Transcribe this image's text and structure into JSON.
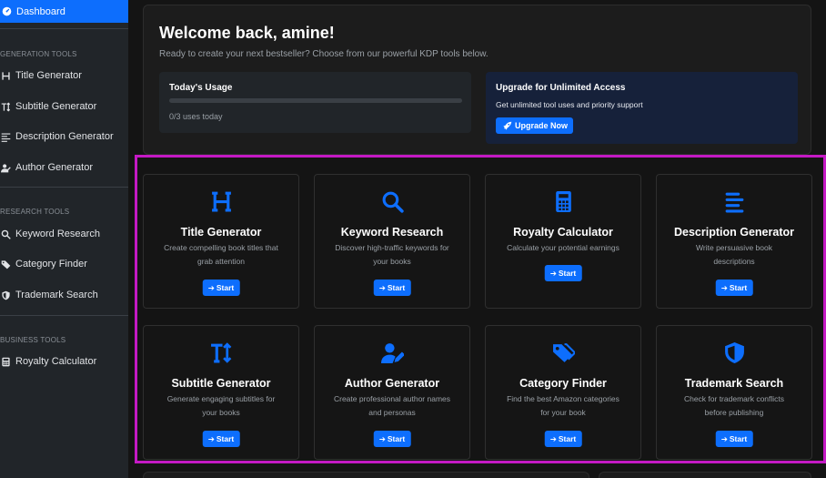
{
  "sidebar": {
    "dashboard": {
      "label": "Dashboard",
      "icon": "dashboard-icon"
    },
    "sections": [
      {
        "heading": "GENERATION TOOLS",
        "items": [
          {
            "label": "Title Generator",
            "icon": "heading-icon"
          },
          {
            "label": "Subtitle Generator",
            "icon": "text-height-icon"
          },
          {
            "label": "Description Generator",
            "icon": "align-left-icon"
          },
          {
            "label": "Author Generator",
            "icon": "user-pen-icon"
          }
        ]
      },
      {
        "heading": "RESEARCH TOOLS",
        "items": [
          {
            "label": "Keyword Research",
            "icon": "search-icon"
          },
          {
            "label": "Category Finder",
            "icon": "tags-icon"
          },
          {
            "label": "Trademark Search",
            "icon": "shield-icon"
          }
        ]
      },
      {
        "heading": "BUSINESS TOOLS",
        "items": [
          {
            "label": "Royalty Calculator",
            "icon": "calculator-icon"
          }
        ]
      }
    ]
  },
  "welcome": {
    "title": "Welcome back, amine!",
    "subtitle": "Ready to create your next bestseller? Choose from our powerful KDP tools below."
  },
  "usage": {
    "title": "Today's Usage",
    "count_text": "0/3 uses today",
    "progress": 0
  },
  "upgrade": {
    "title": "Upgrade for Unlimited Access",
    "description": "Get unlimited tool uses and priority support",
    "button": "Upgrade Now"
  },
  "tools": [
    {
      "title": "Title Generator",
      "desc": "Create compelling book titles that grab attention",
      "button": "Start",
      "icon": "heading-icon"
    },
    {
      "title": "Keyword Research",
      "desc": "Discover high-traffic keywords for your books",
      "button": "Start",
      "icon": "search-icon"
    },
    {
      "title": "Royalty Calculator",
      "desc": "Calculate your potential earnings",
      "button": "Start",
      "icon": "calculator-icon"
    },
    {
      "title": "Description Generator",
      "desc": "Write persuasive book descriptions",
      "button": "Start",
      "icon": "align-left-icon"
    },
    {
      "title": "Subtitle Generator",
      "desc": "Generate engaging subtitles for your books",
      "button": "Start",
      "icon": "text-height-icon"
    },
    {
      "title": "Author Generator",
      "desc": "Create professional author names and personas",
      "button": "Start",
      "icon": "user-pen-icon"
    },
    {
      "title": "Category Finder",
      "desc": "Find the best Amazon categories for your book",
      "button": "Start",
      "icon": "tags-icon"
    },
    {
      "title": "Trademark Search",
      "desc": "Check for trademark conflicts before publishing",
      "button": "Start",
      "icon": "shield-icon"
    }
  ],
  "colors": {
    "accent": "#0d6efd",
    "highlight_border": "#c41ac4",
    "sidebar_bg": "#212529"
  }
}
